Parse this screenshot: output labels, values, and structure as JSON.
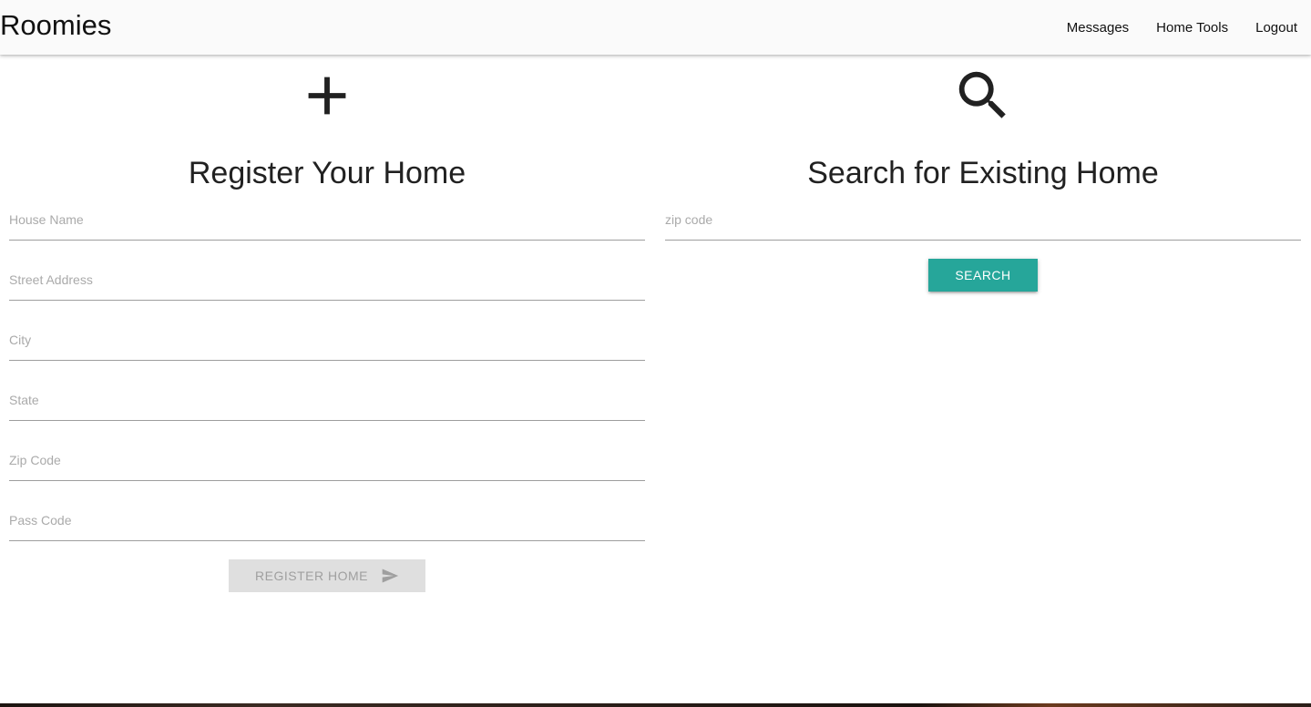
{
  "app": {
    "title": "Roomies"
  },
  "nav": {
    "items": [
      "Messages",
      "Home Tools",
      "Logout"
    ]
  },
  "register": {
    "icon": "plus-icon",
    "title": "Register Your Home",
    "fields": [
      {
        "placeholder": "House Name",
        "value": ""
      },
      {
        "placeholder": "Street Address",
        "value": ""
      },
      {
        "placeholder": "City",
        "value": ""
      },
      {
        "placeholder": "State",
        "value": ""
      },
      {
        "placeholder": "Zip Code",
        "value": ""
      },
      {
        "placeholder": "Pass Code",
        "value": ""
      }
    ],
    "button_label": "REGISTER HOME",
    "button_icon": "send-icon"
  },
  "search": {
    "icon": "search-icon",
    "title": "Search for Existing Home",
    "field": {
      "placeholder": "zip code",
      "value": ""
    },
    "button_label": "SEARCH"
  },
  "colors": {
    "accent": "#26a69a",
    "navbar_bg": "#fafafa",
    "disabled_button_bg": "#dfdfdf",
    "disabled_button_text": "#9f9f9f"
  }
}
